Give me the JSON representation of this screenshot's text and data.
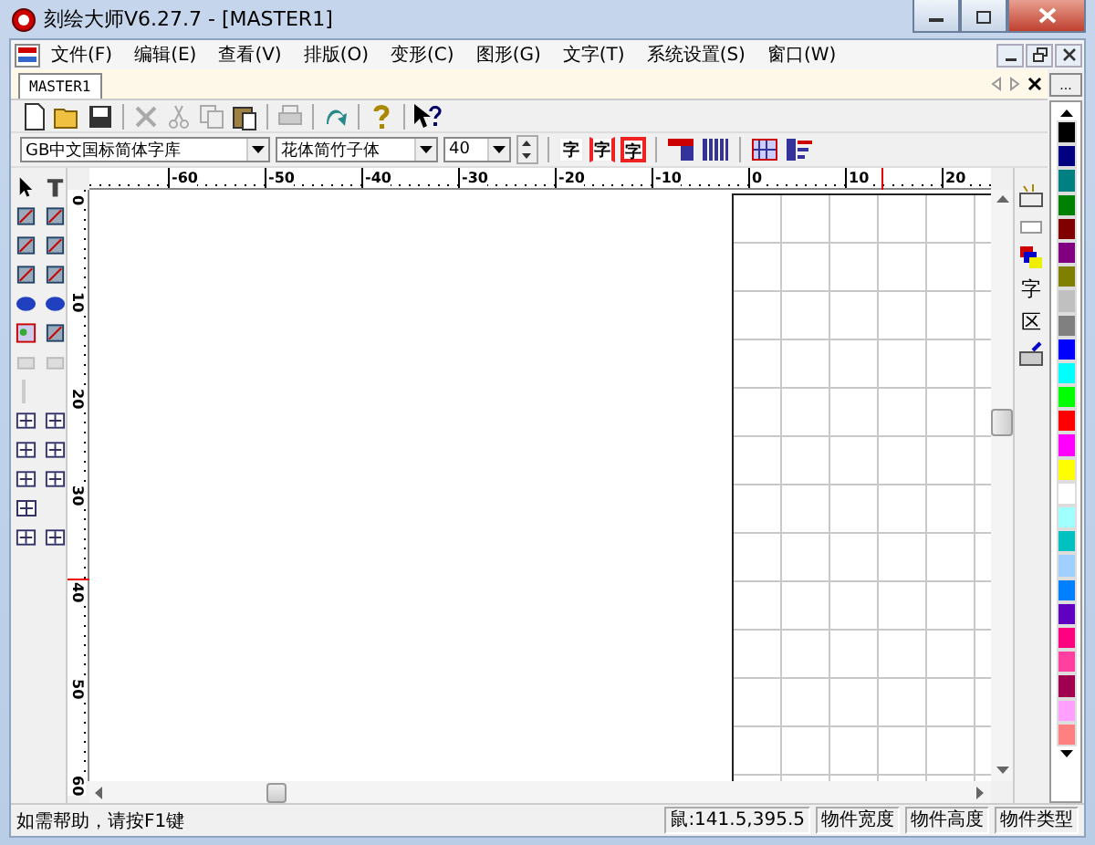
{
  "window": {
    "title": "刻绘大师V6.27.7 - [MASTER1]"
  },
  "menu": [
    {
      "label": "文件(F)"
    },
    {
      "label": "编辑(E)"
    },
    {
      "label": "查看(V)"
    },
    {
      "label": "排版(O)"
    },
    {
      "label": "变形(C)"
    },
    {
      "label": "图形(G)"
    },
    {
      "label": "文字(T)"
    },
    {
      "label": "系统设置(S)"
    },
    {
      "label": "窗口(W)"
    }
  ],
  "tabs": [
    {
      "label": "MASTER1",
      "selected": true
    }
  ],
  "font_toolbar": {
    "font_library": "GB中文国标简体字库",
    "font_name": "花体简竹子体",
    "font_size": "40",
    "style_buttons": [
      "字",
      "字",
      "字"
    ]
  },
  "rulers": {
    "horizontal": [
      "-60",
      "-50",
      "-40",
      "-30",
      "-20",
      "-10",
      "0",
      "10",
      "20"
    ],
    "vertical": [
      "0",
      "10",
      "20",
      "30",
      "40",
      "50",
      "60"
    ]
  },
  "side_panel": {
    "buttons": [
      "字",
      "区"
    ]
  },
  "palette": {
    "more_button": "...",
    "swatches": [
      {
        "color": "#000000"
      },
      {
        "color": "#000080"
      },
      {
        "color": "#008080"
      },
      {
        "color": "#008000"
      },
      {
        "color": "#800000"
      },
      {
        "color": "#800080"
      },
      {
        "color": "#808000"
      },
      {
        "color": "#c0c0c0"
      },
      {
        "color": "#808080"
      },
      {
        "color": "#0000ff"
      },
      {
        "color": "#00ffff"
      },
      {
        "color": "#00ff00"
      },
      {
        "color": "#ff0000"
      },
      {
        "color": "#ff00ff"
      },
      {
        "color": "#ffff00"
      },
      {
        "color": "#ffffff"
      },
      {
        "color": "#a0ffff"
      },
      {
        "color": "#00c0c0"
      },
      {
        "color": "#a0d0ff"
      },
      {
        "color": "#0080ff"
      },
      {
        "color": "#6000c0"
      },
      {
        "color": "#ff0080"
      },
      {
        "color": "#ff40a0"
      },
      {
        "color": "#a00050"
      },
      {
        "color": "#ffa0ff"
      },
      {
        "color": "#ff8080"
      }
    ]
  },
  "status_bar": {
    "help": "如需帮助，请按F1键",
    "mouse": "鼠:141.5,395.5",
    "width": "物件宽度",
    "height": "物件高度",
    "type": "物件类型"
  }
}
